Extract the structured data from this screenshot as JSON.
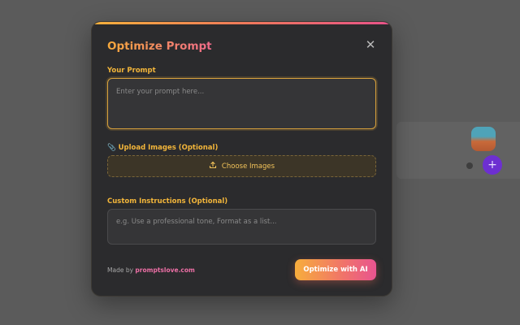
{
  "modal": {
    "title": "Optimize Prompt",
    "close_icon": "close-icon",
    "prompt_label": "Your Prompt",
    "prompt_placeholder": "Enter your prompt here...",
    "upload_label": "Upload Images (Optional)",
    "upload_button": "Choose Images",
    "custom_label": "Custom Instructions (Optional)",
    "custom_placeholder": "e.g. Use a professional tone, Format as a list...",
    "footer": {
      "made_by_prefix": "Made by",
      "made_by_link": "promptslove.com"
    },
    "optimize_button": "Optimize with AI"
  },
  "colors": {
    "accent_gold": "#f2b53a",
    "accent_pink": "#e8528a",
    "modal_bg": "#2b2b2d",
    "overlay": "#5b5b5b"
  },
  "background": {
    "fab_icon": "plus-icon"
  }
}
